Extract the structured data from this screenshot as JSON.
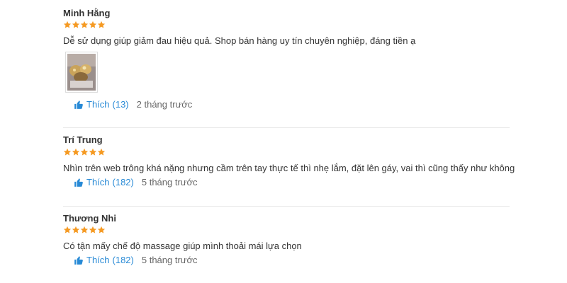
{
  "reviews": [
    {
      "name": "Minh Hằng",
      "rating": 5,
      "text": "Dễ sử dụng giúp giảm đau hiệu quả. Shop bán hàng uy tín chuyên nghiệp, đáng tiền ạ",
      "has_photo": true,
      "like_label": "Thích",
      "like_count": "(13)",
      "time": "2 tháng trước"
    },
    {
      "name": "Trí Trung",
      "rating": 5,
      "text": "Nhìn trên web trông khá nặng nhưng cầm trên tay thực tế thì nhẹ lắm, đặt lên gáy, vai thì cũng thấy như không",
      "has_photo": false,
      "like_label": "Thích",
      "like_count": "(182)",
      "time": "5 tháng trước"
    },
    {
      "name": "Thương Nhi",
      "rating": 5,
      "text": "Có tận mấy chế độ massage giúp mình thoải mái lựa chọn",
      "has_photo": false,
      "like_label": "Thích",
      "like_count": "(182)",
      "time": "5 tháng trước"
    }
  ],
  "colors": {
    "star": "#f59a23",
    "like": "#288ad6",
    "time": "#666666",
    "divider": "#e8e8e8"
  },
  "icons": {
    "star": "star-icon",
    "like": "thumbs-up-icon"
  }
}
